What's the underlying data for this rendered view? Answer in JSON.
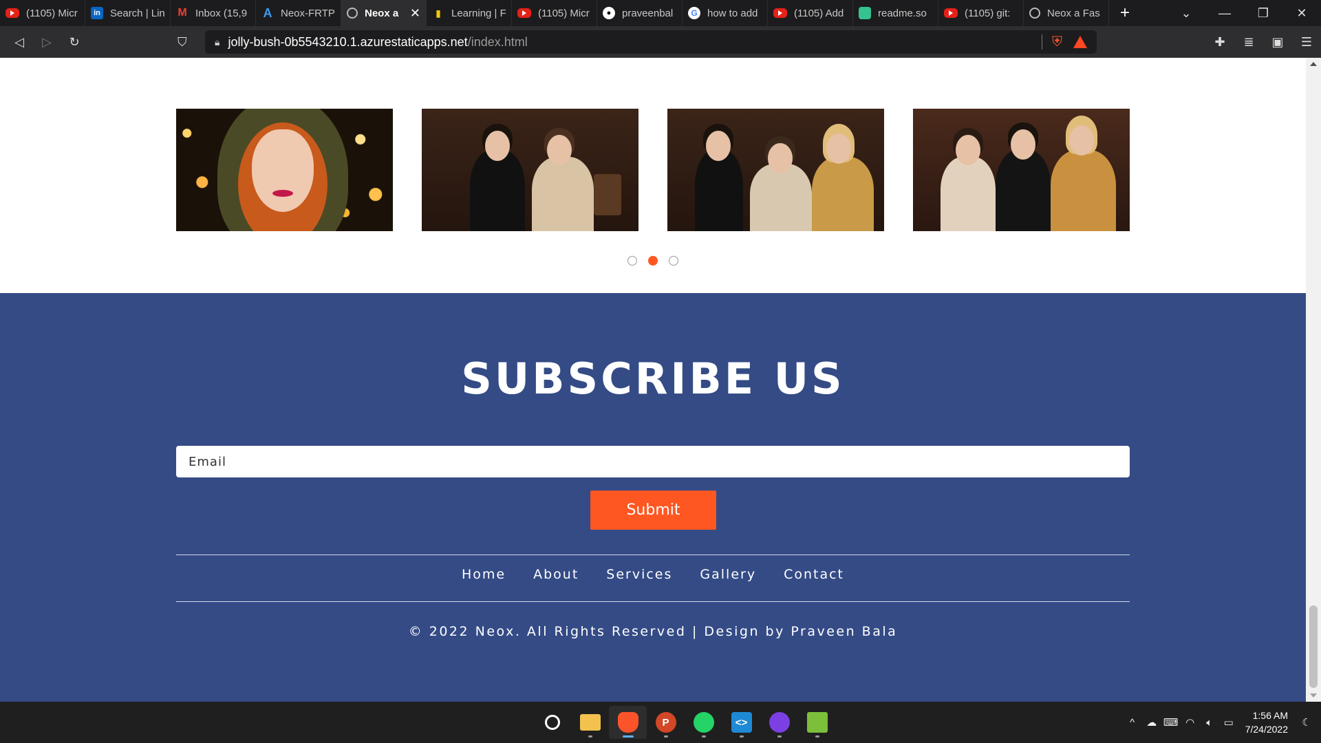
{
  "browser": {
    "tabs": [
      {
        "label": "(1105) Micr",
        "icon": "youtube-icon",
        "fav": "yt",
        "glyph": ""
      },
      {
        "label": "Search | Lin",
        "icon": "linkedin-icon",
        "fav": "li",
        "glyph": "in"
      },
      {
        "label": "Inbox (15,9",
        "icon": "gmail-icon",
        "fav": "gm",
        "glyph": "M"
      },
      {
        "label": "Neox-FRTP",
        "icon": "azure-icon",
        "fav": "az",
        "glyph": "A"
      },
      {
        "label": "Neox a",
        "icon": "globe-icon",
        "fav": "globe",
        "glyph": "",
        "active": true
      },
      {
        "label": "Learning | F",
        "icon": "powerbi-icon",
        "fav": "pbi",
        "glyph": "▮"
      },
      {
        "label": "(1105) Micr",
        "icon": "youtube-icon",
        "fav": "yt",
        "glyph": ""
      },
      {
        "label": "praveenbal",
        "icon": "github-icon",
        "fav": "gh",
        "glyph": "●"
      },
      {
        "label": "how to add",
        "icon": "google-icon",
        "fav": "gg",
        "glyph": "G"
      },
      {
        "label": "(1105) Add",
        "icon": "youtube-icon",
        "fav": "yt",
        "glyph": ""
      },
      {
        "label": "readme.so",
        "icon": "readme-icon",
        "fav": "rs",
        "glyph": ""
      },
      {
        "label": "(1105) git: ",
        "icon": "youtube-icon",
        "fav": "yt",
        "glyph": ""
      },
      {
        "label": "Neox a Fas",
        "icon": "globe-icon",
        "fav": "globe",
        "glyph": ""
      }
    ],
    "new_tab": "+",
    "url_domain": "jolly-bush-0b5543210.1.azurestaticapps.net",
    "url_path": "/index.html"
  },
  "gallery": {
    "images": [
      {
        "alt": "Woman with red hair in green hood"
      },
      {
        "alt": "Two women in vintage dresses with champagne"
      },
      {
        "alt": "Three women in vintage dresses toasting"
      },
      {
        "alt": "Three women laughing with champagne"
      }
    ],
    "dots": [
      false,
      true,
      false
    ]
  },
  "subscribe": {
    "title": "SUBSCRIBE US",
    "email_placeholder": "Email",
    "submit_label": "Submit"
  },
  "footer": {
    "nav": [
      "Home",
      "About",
      "Services",
      "Gallery",
      "Contact"
    ],
    "copyright": "© 2022 Neox. All Rights Reserved | Design by Praveen Bala"
  },
  "taskbar": {
    "apps": [
      {
        "name": "start-button",
        "icon": "windows-icon",
        "cls": "win",
        "label": ""
      },
      {
        "name": "search-button",
        "icon": "search-icon",
        "cls": "search",
        "label": ""
      },
      {
        "name": "file-explorer",
        "icon": "folder-icon",
        "cls": "folder",
        "label": ""
      },
      {
        "name": "brave-browser",
        "icon": "brave-icon",
        "cls": "brave",
        "label": "",
        "active": true
      },
      {
        "name": "powerpoint",
        "icon": "powerpoint-icon",
        "cls": "ppt",
        "label": "P"
      },
      {
        "name": "whatsapp",
        "icon": "whatsapp-icon",
        "cls": "wa",
        "label": ""
      },
      {
        "name": "vscode",
        "icon": "vscode-icon",
        "cls": "vs",
        "label": "<>"
      },
      {
        "name": "github-desktop",
        "icon": "github-icon",
        "cls": "gh",
        "label": ""
      },
      {
        "name": "notepad",
        "icon": "notepad-icon",
        "cls": "np",
        "label": ""
      }
    ],
    "time": "1:56 AM",
    "date": "7/24/2022"
  },
  "colors": {
    "accent": "#ff5722",
    "footer_bg": "#344b86"
  }
}
